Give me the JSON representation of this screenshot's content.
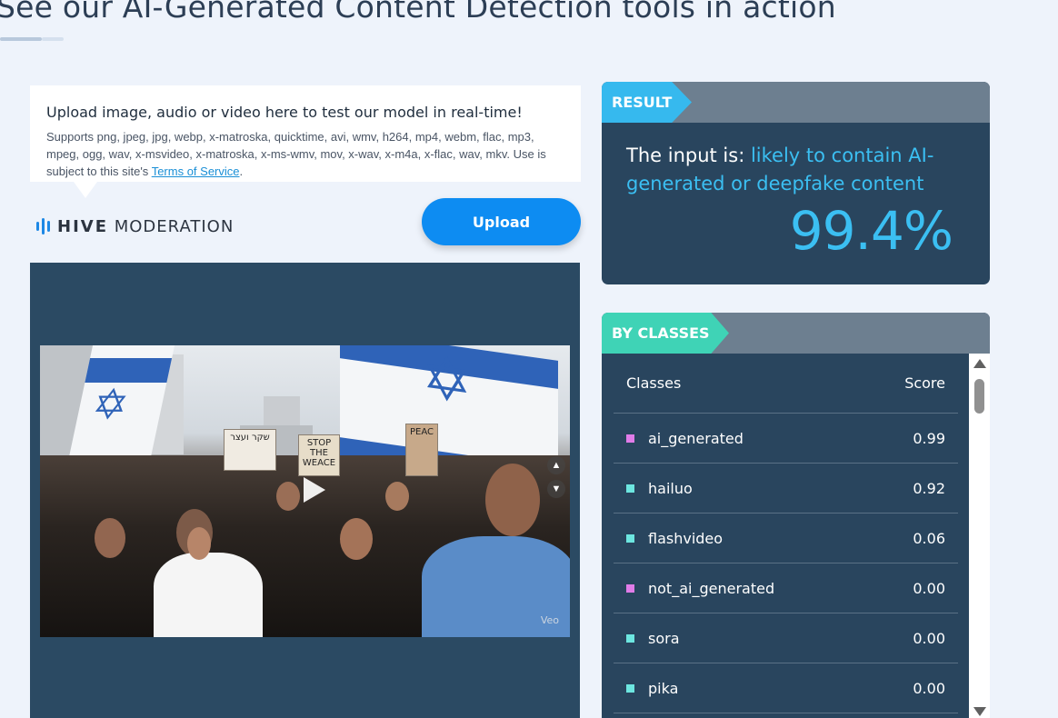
{
  "page": {
    "title": "See our AI-Generated Content Detection tools in action"
  },
  "upload": {
    "heading": "Upload image, audio or video here to test our model in real-time!",
    "description": "Supports png, jpeg, jpg, webp, x-matroska, quicktime, avi, wmv, h264, mp4, webm, flac, mp3, mpeg, ogg, wav, x-msvideo, x-matroska, x-ms-wmv, mov, x-wav, x-m4a, x-flac, wav, mkv. Use is subject to this site's",
    "terms_link": "Terms of Service",
    "terms_suffix": ".",
    "button_label": "Upload"
  },
  "logo": {
    "brand_bold": "HIVE",
    "brand_light": "MODERATION"
  },
  "preview": {
    "signs": [
      "שקר ועצר",
      "STOP THE WEACE",
      "PEAC"
    ],
    "watermark": "Veo"
  },
  "result": {
    "header": "RESULT",
    "prefix": "The input is: ",
    "verdict": "likely to contain AI-generated or deepfake content",
    "score": "99.4%"
  },
  "classes": {
    "header": "BY CLASSES",
    "col_classes": "Classes",
    "col_score": "Score",
    "rows": [
      {
        "name": "ai_generated",
        "score": "0.99",
        "color": "#e07ce8"
      },
      {
        "name": "hailuo",
        "score": "0.92",
        "color": "#6de6e0"
      },
      {
        "name": "flashvideo",
        "score": "0.06",
        "color": "#6de6e0"
      },
      {
        "name": "not_ai_generated",
        "score": "0.00",
        "color": "#e07ce8"
      },
      {
        "name": "sora",
        "score": "0.00",
        "color": "#6de6e0"
      },
      {
        "name": "pika",
        "score": "0.00",
        "color": "#6de6e0"
      }
    ]
  },
  "colors": {
    "accent": "#0d8cf2",
    "result_tag": "#36b9ee",
    "classes_tag": "#3fd3b6",
    "panel_bg": "#29455e"
  }
}
